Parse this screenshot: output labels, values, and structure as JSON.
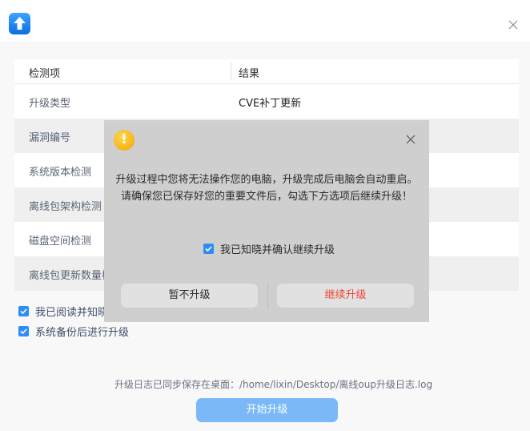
{
  "table": {
    "headers": [
      "检测项",
      "结果"
    ],
    "rows": [
      {
        "label": "升级类型",
        "value": "CVE补丁更新"
      },
      {
        "label": "漏洞编号",
        "value": ""
      },
      {
        "label": "系统版本检测",
        "value": ""
      },
      {
        "label": "离线包架构检测",
        "value": ""
      },
      {
        "label": "磁盘空间检测",
        "value": ""
      },
      {
        "label": "离线包更新数量检",
        "value": ""
      }
    ]
  },
  "options": [
    {
      "label": "我已阅读并知晓",
      "checked": true
    },
    {
      "label": "系统备份后进行升级",
      "checked": true
    }
  ],
  "log_text": "升级日志已同步保存在桌面：/home/lixin/Desktop/离线oup升级日志.log",
  "start_button": "开始升级",
  "dialog": {
    "message_line1": "升级过程中您将无法操作您的电脑，升级完成后电脑会自动重启。",
    "message_line2": "请确保您已保存好您的重要文件后，勾选下方选项后继续升级！",
    "confirm_check_label": "我已知晓并确认继续升级",
    "cancel_button": "暂不升级",
    "continue_button": "继续升级",
    "warning_glyph": "!",
    "continue_color": "#f04437"
  },
  "colors": {
    "accent": "#2f8cf4",
    "start_button": "#7ab8f8"
  }
}
